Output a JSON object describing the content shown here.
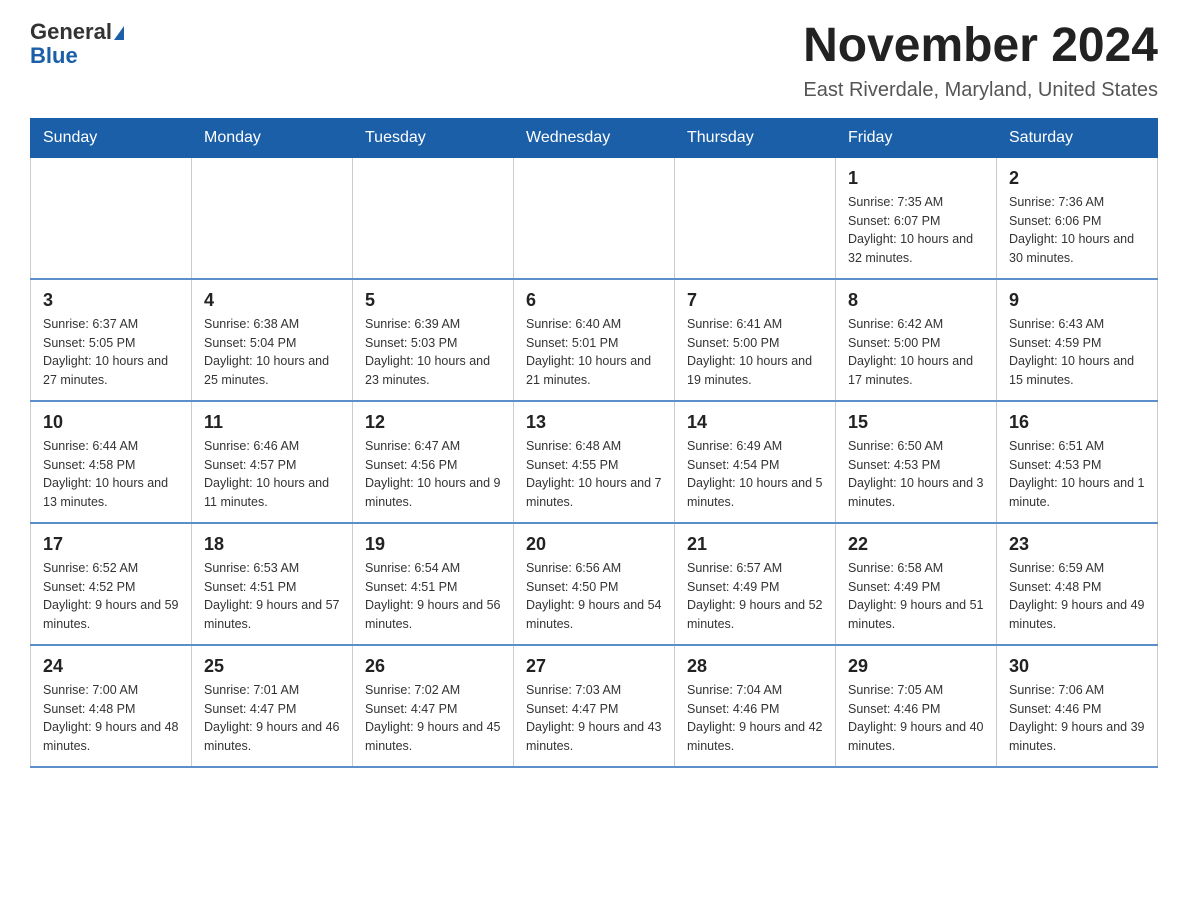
{
  "logo": {
    "line1": "General",
    "line2": "Blue"
  },
  "title": "November 2024",
  "subtitle": "East Riverdale, Maryland, United States",
  "days_of_week": [
    "Sunday",
    "Monday",
    "Tuesday",
    "Wednesday",
    "Thursday",
    "Friday",
    "Saturday"
  ],
  "weeks": [
    [
      {
        "day": "",
        "info": ""
      },
      {
        "day": "",
        "info": ""
      },
      {
        "day": "",
        "info": ""
      },
      {
        "day": "",
        "info": ""
      },
      {
        "day": "",
        "info": ""
      },
      {
        "day": "1",
        "info": "Sunrise: 7:35 AM\nSunset: 6:07 PM\nDaylight: 10 hours and 32 minutes."
      },
      {
        "day": "2",
        "info": "Sunrise: 7:36 AM\nSunset: 6:06 PM\nDaylight: 10 hours and 30 minutes."
      }
    ],
    [
      {
        "day": "3",
        "info": "Sunrise: 6:37 AM\nSunset: 5:05 PM\nDaylight: 10 hours and 27 minutes."
      },
      {
        "day": "4",
        "info": "Sunrise: 6:38 AM\nSunset: 5:04 PM\nDaylight: 10 hours and 25 minutes."
      },
      {
        "day": "5",
        "info": "Sunrise: 6:39 AM\nSunset: 5:03 PM\nDaylight: 10 hours and 23 minutes."
      },
      {
        "day": "6",
        "info": "Sunrise: 6:40 AM\nSunset: 5:01 PM\nDaylight: 10 hours and 21 minutes."
      },
      {
        "day": "7",
        "info": "Sunrise: 6:41 AM\nSunset: 5:00 PM\nDaylight: 10 hours and 19 minutes."
      },
      {
        "day": "8",
        "info": "Sunrise: 6:42 AM\nSunset: 5:00 PM\nDaylight: 10 hours and 17 minutes."
      },
      {
        "day": "9",
        "info": "Sunrise: 6:43 AM\nSunset: 4:59 PM\nDaylight: 10 hours and 15 minutes."
      }
    ],
    [
      {
        "day": "10",
        "info": "Sunrise: 6:44 AM\nSunset: 4:58 PM\nDaylight: 10 hours and 13 minutes."
      },
      {
        "day": "11",
        "info": "Sunrise: 6:46 AM\nSunset: 4:57 PM\nDaylight: 10 hours and 11 minutes."
      },
      {
        "day": "12",
        "info": "Sunrise: 6:47 AM\nSunset: 4:56 PM\nDaylight: 10 hours and 9 minutes."
      },
      {
        "day": "13",
        "info": "Sunrise: 6:48 AM\nSunset: 4:55 PM\nDaylight: 10 hours and 7 minutes."
      },
      {
        "day": "14",
        "info": "Sunrise: 6:49 AM\nSunset: 4:54 PM\nDaylight: 10 hours and 5 minutes."
      },
      {
        "day": "15",
        "info": "Sunrise: 6:50 AM\nSunset: 4:53 PM\nDaylight: 10 hours and 3 minutes."
      },
      {
        "day": "16",
        "info": "Sunrise: 6:51 AM\nSunset: 4:53 PM\nDaylight: 10 hours and 1 minute."
      }
    ],
    [
      {
        "day": "17",
        "info": "Sunrise: 6:52 AM\nSunset: 4:52 PM\nDaylight: 9 hours and 59 minutes."
      },
      {
        "day": "18",
        "info": "Sunrise: 6:53 AM\nSunset: 4:51 PM\nDaylight: 9 hours and 57 minutes."
      },
      {
        "day": "19",
        "info": "Sunrise: 6:54 AM\nSunset: 4:51 PM\nDaylight: 9 hours and 56 minutes."
      },
      {
        "day": "20",
        "info": "Sunrise: 6:56 AM\nSunset: 4:50 PM\nDaylight: 9 hours and 54 minutes."
      },
      {
        "day": "21",
        "info": "Sunrise: 6:57 AM\nSunset: 4:49 PM\nDaylight: 9 hours and 52 minutes."
      },
      {
        "day": "22",
        "info": "Sunrise: 6:58 AM\nSunset: 4:49 PM\nDaylight: 9 hours and 51 minutes."
      },
      {
        "day": "23",
        "info": "Sunrise: 6:59 AM\nSunset: 4:48 PM\nDaylight: 9 hours and 49 minutes."
      }
    ],
    [
      {
        "day": "24",
        "info": "Sunrise: 7:00 AM\nSunset: 4:48 PM\nDaylight: 9 hours and 48 minutes."
      },
      {
        "day": "25",
        "info": "Sunrise: 7:01 AM\nSunset: 4:47 PM\nDaylight: 9 hours and 46 minutes."
      },
      {
        "day": "26",
        "info": "Sunrise: 7:02 AM\nSunset: 4:47 PM\nDaylight: 9 hours and 45 minutes."
      },
      {
        "day": "27",
        "info": "Sunrise: 7:03 AM\nSunset: 4:47 PM\nDaylight: 9 hours and 43 minutes."
      },
      {
        "day": "28",
        "info": "Sunrise: 7:04 AM\nSunset: 4:46 PM\nDaylight: 9 hours and 42 minutes."
      },
      {
        "day": "29",
        "info": "Sunrise: 7:05 AM\nSunset: 4:46 PM\nDaylight: 9 hours and 40 minutes."
      },
      {
        "day": "30",
        "info": "Sunrise: 7:06 AM\nSunset: 4:46 PM\nDaylight: 9 hours and 39 minutes."
      }
    ]
  ]
}
